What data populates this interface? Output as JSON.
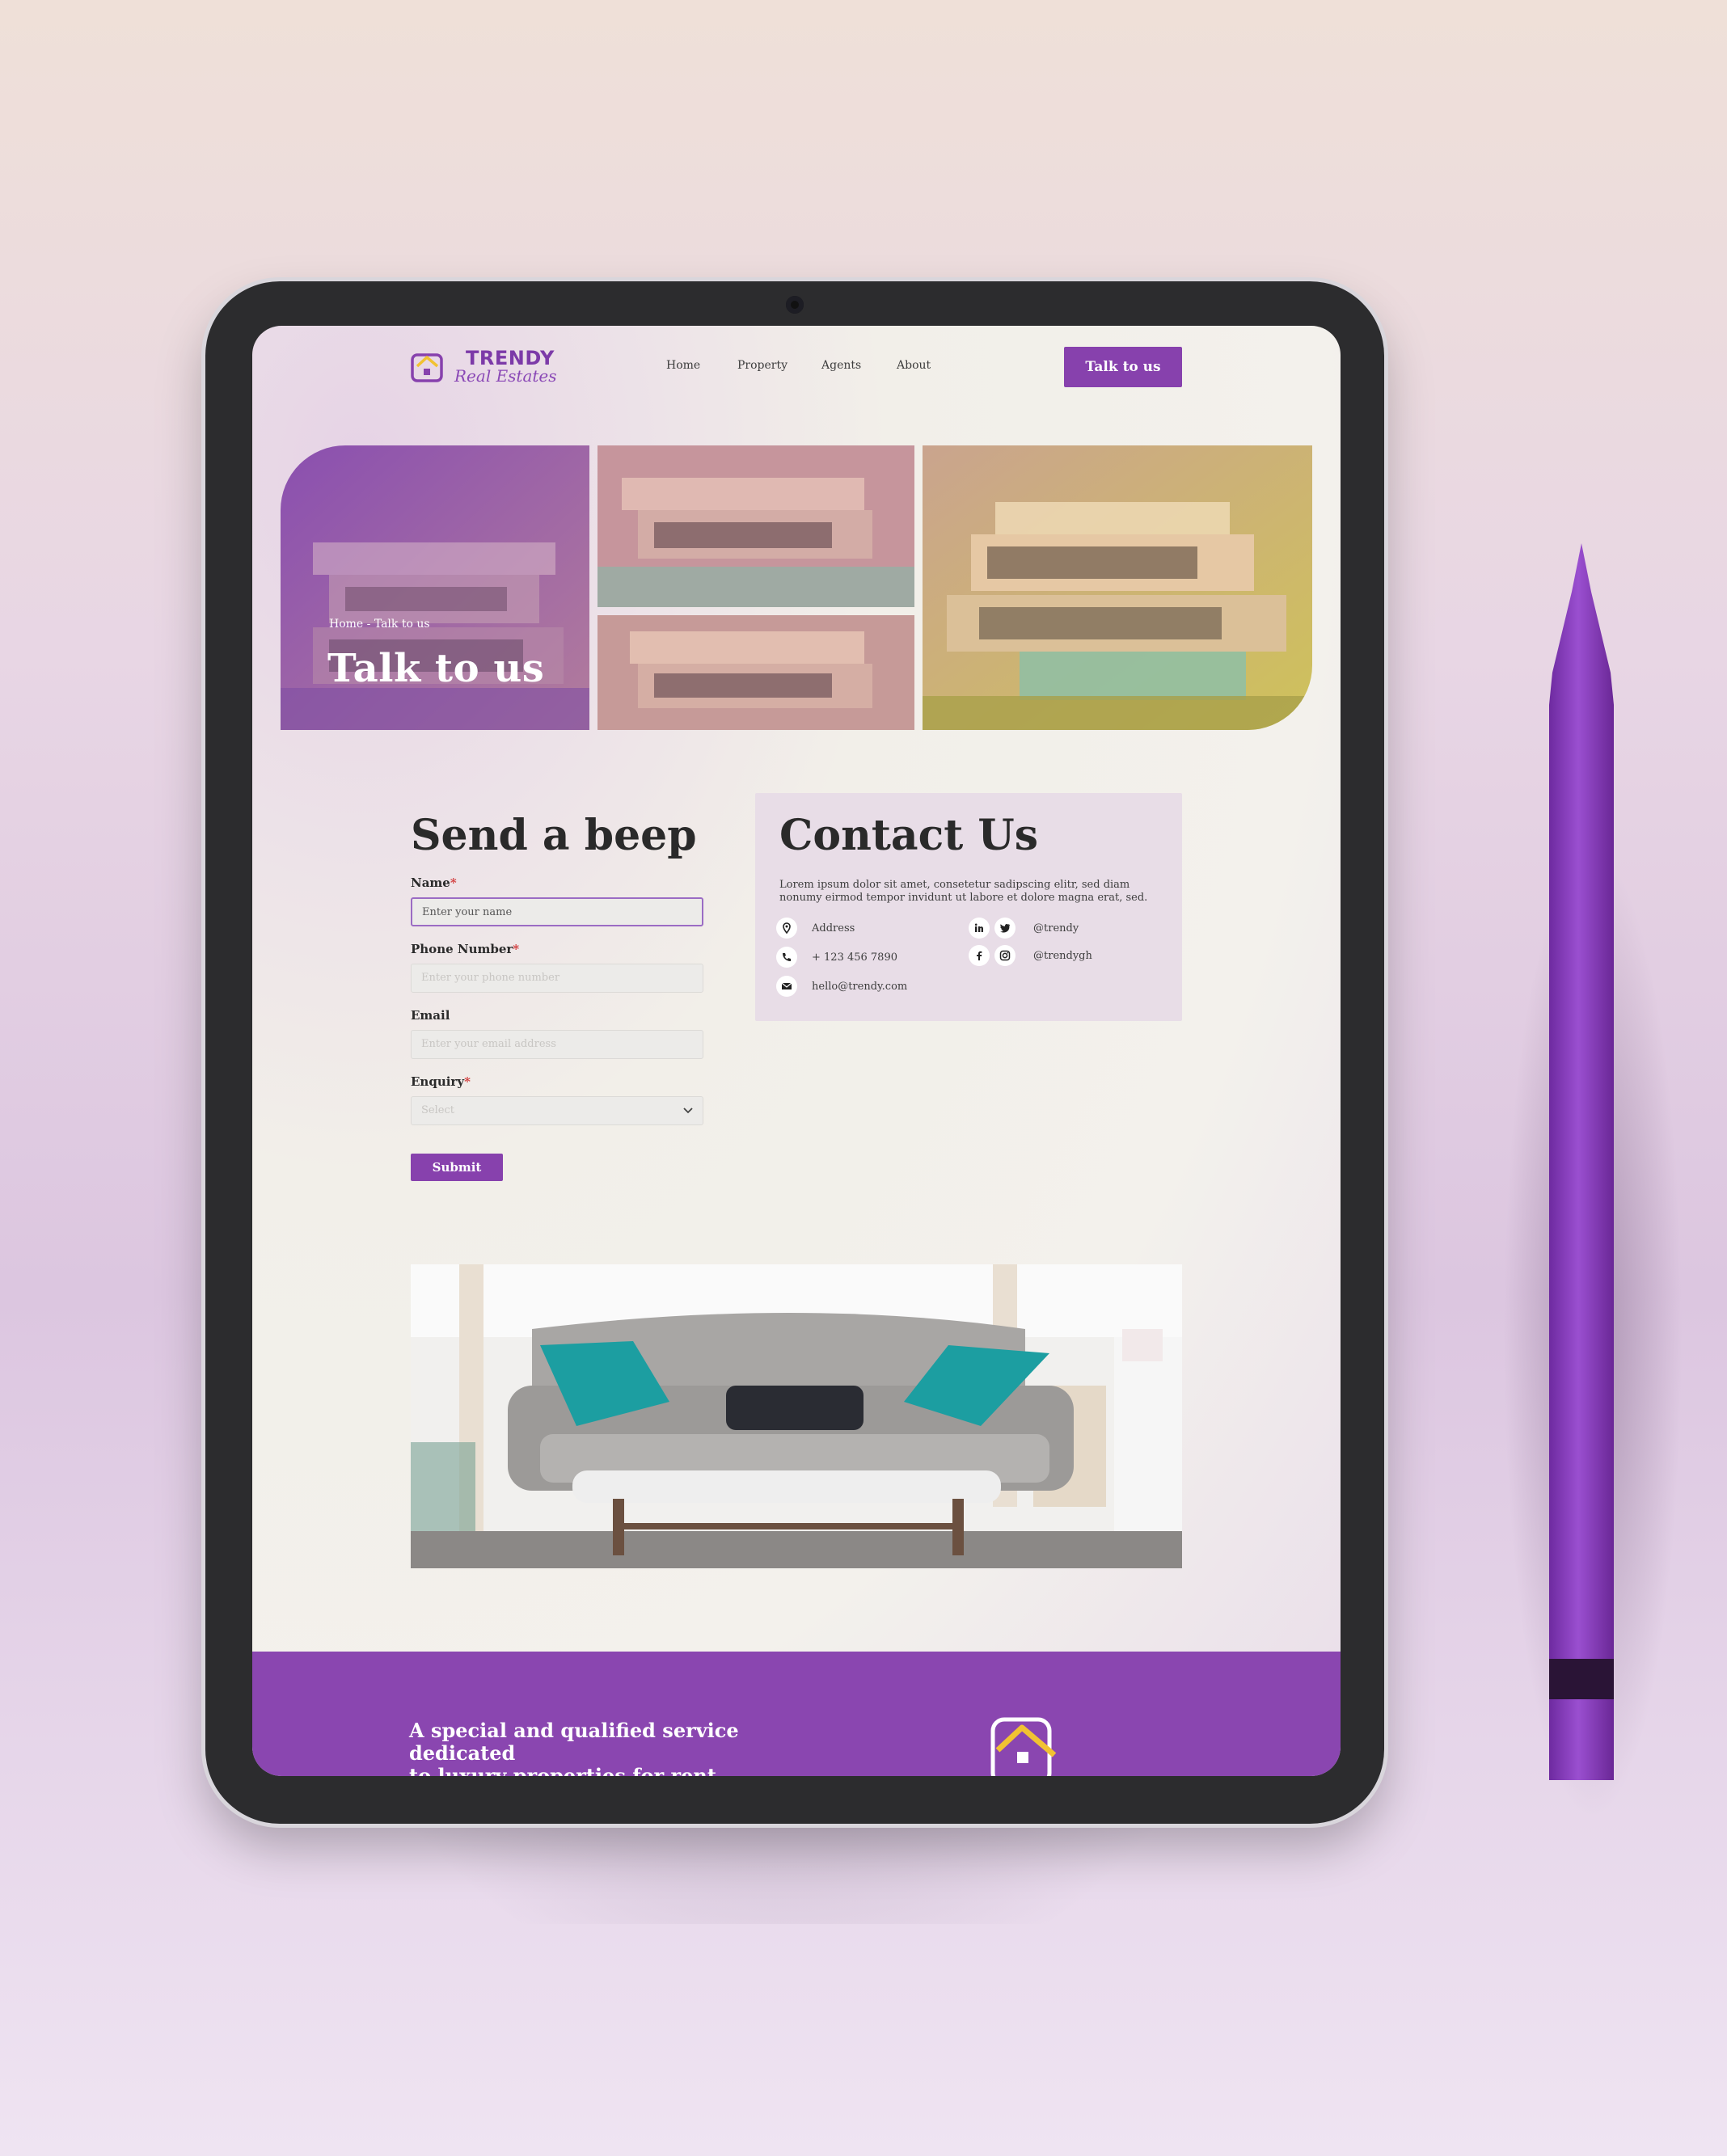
{
  "header": {
    "logo_title": "TRENDY",
    "logo_subtitle": "Real Estates",
    "nav": [
      "Home",
      "Property",
      "Agents",
      "About"
    ],
    "cta_label": "Talk to us"
  },
  "hero": {
    "breadcrumb": "Home - Talk to us",
    "title": "Talk to us"
  },
  "form": {
    "title": "Send a beep",
    "fields": [
      {
        "label": "Name",
        "required": "*",
        "placeholder": "Enter your name"
      },
      {
        "label": "Phone Number",
        "required": "*",
        "placeholder": "Enter your phone number"
      },
      {
        "label": "Email",
        "required": "",
        "placeholder": "Enter your email address"
      },
      {
        "label": "Enquiry",
        "required": "*",
        "placeholder": "Select"
      }
    ],
    "submit_label": "Submit"
  },
  "contact": {
    "title": "Contact Us",
    "description": "Lorem ipsum dolor sit amet, consetetur sadipscing elitr, sed diam nonumy eirmod tempor invidunt ut labore et dolore magna erat, sed.",
    "address": "Address",
    "phone": "+ 123 456 7890",
    "email": "hello@trendy.com",
    "social_handle_1": "@trendy",
    "social_handle_2": "@trendygh"
  },
  "footer": {
    "tagline_line1": "A special and qualified service dedicated",
    "tagline_line2": "to luxury properties for rent"
  },
  "colors": {
    "brand_purple": "#8741ad",
    "accent_yellow": "#f1c232",
    "required_red": "#d23b3b",
    "pen_purple": "#8e3fc0"
  }
}
